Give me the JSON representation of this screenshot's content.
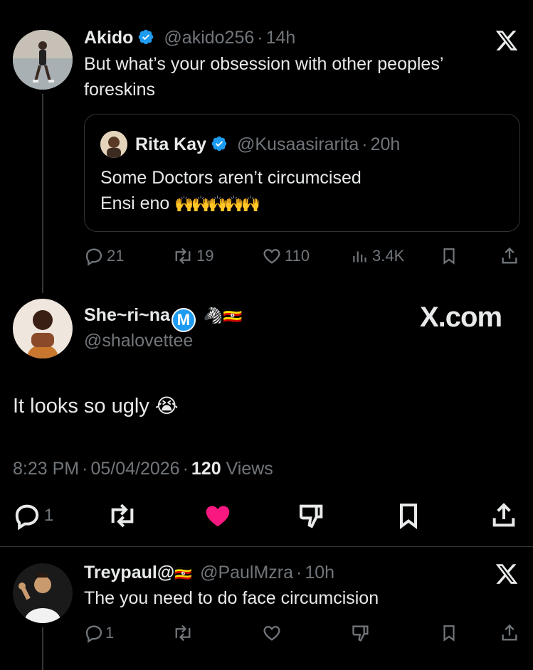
{
  "tweet1": {
    "name": "Akido",
    "handle": "@akido256",
    "time": "14h",
    "text": "But what’s your obsession with other peoples’ foreskins",
    "quote": {
      "name": "Rita Kay",
      "handle": "@Kusaasirarita",
      "time": "20h",
      "line1": "Some Doctors aren’t circumcised",
      "line2": "Ensi eno",
      "emojis": "🙌🙌🙌🙌🙌"
    },
    "stats": {
      "replies": "21",
      "reposts": "19",
      "likes": "110",
      "views": "3.4K"
    }
  },
  "main": {
    "name": "She~ri~na",
    "badge_letter": "M",
    "name_emojis": "🦓🇺🇬",
    "handle": "@shalovettee",
    "brand": "X.com",
    "text": "It looks so ugly",
    "text_emoji": "😭",
    "time": "8:23 PM",
    "date": "05/04/2026",
    "views_count": "120",
    "views_label": "Views",
    "reply_count": "1",
    "like_color": "#f91880"
  },
  "tweet3": {
    "name": "Treypaul@",
    "flag": "🇺🇬",
    "handle": "@PaulMzra",
    "time": "10h",
    "text": "The you need to do face circumcision",
    "reply_count": "1"
  },
  "colors": {
    "verified": "#1d9bf0",
    "muted": "#71767b",
    "like": "#f91880"
  }
}
